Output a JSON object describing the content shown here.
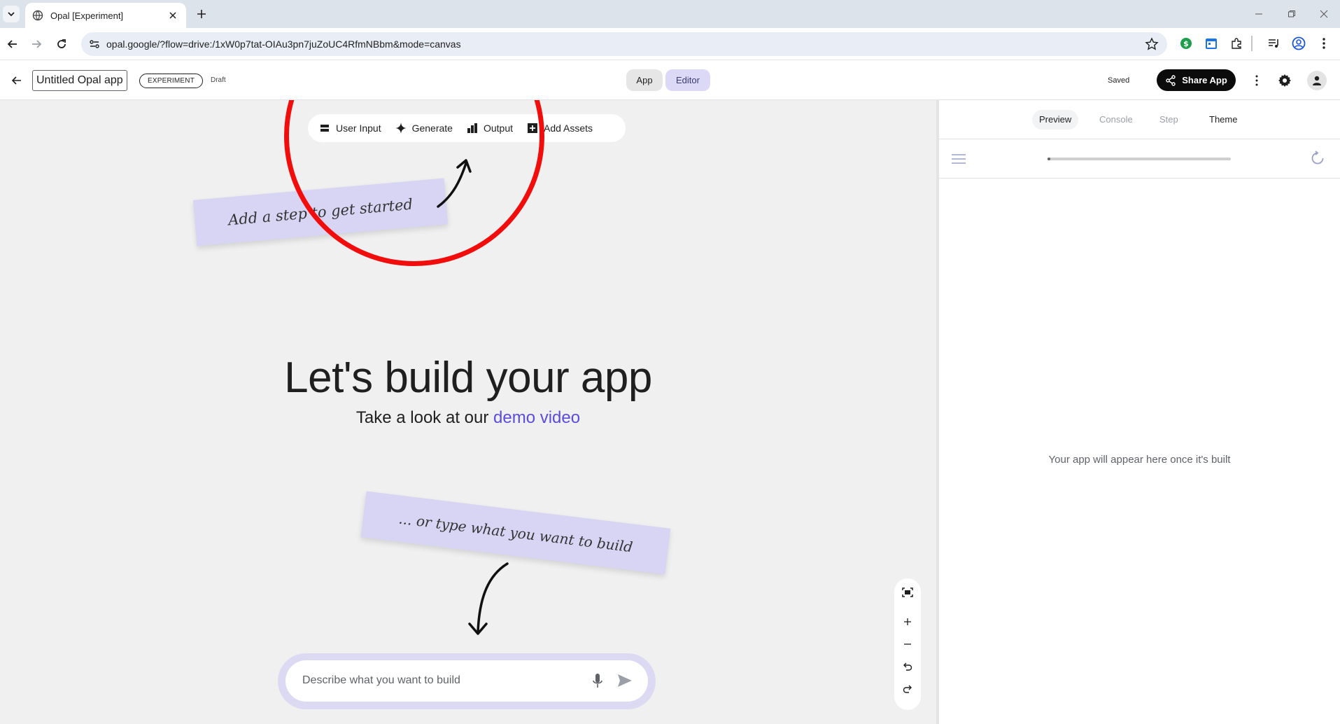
{
  "browser": {
    "tab_title": "Opal [Experiment]",
    "url": "opal.google/?flow=drive:/1xW0p7tat-OIAu3pn7juZoUC4RfmNBbm&mode=canvas"
  },
  "header": {
    "app_title": "Untitled Opal app",
    "badge": "EXPERIMENT",
    "status": "Draft",
    "modes": {
      "app": "App",
      "editor": "Editor",
      "active": "Editor"
    },
    "saved_label": "Saved",
    "share_label": "Share App"
  },
  "canvas": {
    "toolbar": [
      {
        "label": "User Input",
        "icon": "user-input-icon"
      },
      {
        "label": "Generate",
        "icon": "sparkle-icon"
      },
      {
        "label": "Output",
        "icon": "output-icon"
      },
      {
        "label": "Add Assets",
        "icon": "add-assets-icon"
      }
    ],
    "note_top": "Add a step to get started",
    "note_bottom": "... or type what you want to build",
    "headline": "Let's build your app",
    "subline_prefix": "Take a look at our ",
    "subline_link": "demo video",
    "prompt_placeholder": "Describe what you want to build"
  },
  "panel": {
    "tabs": [
      {
        "label": "Preview",
        "state": "active"
      },
      {
        "label": "Console",
        "state": "muted"
      },
      {
        "label": "Step",
        "state": "muted"
      },
      {
        "label": "Theme",
        "state": "normal"
      }
    ],
    "progress": 0.01,
    "empty_message": "Your app will appear here once it's built"
  },
  "colors": {
    "highlight_circle": "#f20d0d",
    "note_bg": "#d7d5f3",
    "link": "#5b4ce0",
    "editor_active": "#dcd9f7",
    "share_button": "#0b0b0b"
  }
}
